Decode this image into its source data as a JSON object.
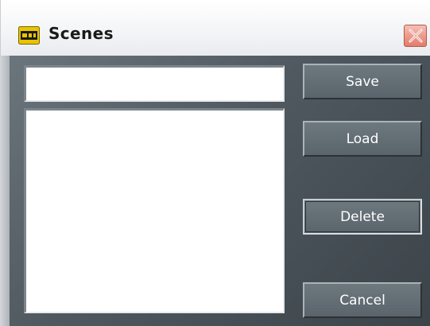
{
  "window": {
    "title": "Scenes",
    "icon": "scenes-app-icon",
    "close_icon": "close-icon"
  },
  "form": {
    "scene_name_value": "",
    "scene_list_items": []
  },
  "buttons": {
    "save_label": "Save",
    "load_label": "Load",
    "delete_label": "Delete",
    "cancel_label": "Cancel"
  },
  "colors": {
    "panel_dark": "#4f585f",
    "button_text": "#ffffff",
    "close_button": "#e37c6b",
    "icon_yellow": "#e8c400"
  }
}
